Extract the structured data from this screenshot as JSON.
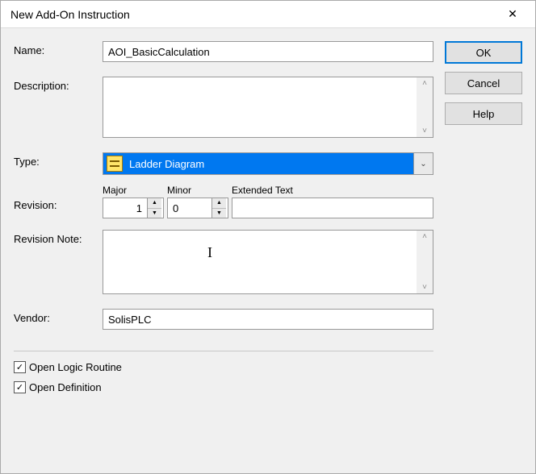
{
  "window": {
    "title": "New Add-On Instruction"
  },
  "buttons": {
    "ok": "OK",
    "cancel": "Cancel",
    "help": "Help"
  },
  "labels": {
    "name": "Name:",
    "description": "Description:",
    "type": "Type:",
    "revision": "Revision:",
    "revision_note": "Revision Note:",
    "vendor": "Vendor:",
    "major": "Major",
    "minor": "Minor",
    "extended_text": "Extended Text"
  },
  "fields": {
    "name": "AOI_BasicCalculation",
    "description": "",
    "type_selected": "Ladder Diagram",
    "major": "1",
    "minor": "0",
    "extended_text": "",
    "revision_note": "",
    "vendor": "SolisPLC"
  },
  "checks": {
    "open_logic_label": "Open Logic Routine",
    "open_logic_checked": true,
    "open_definition_label": "Open Definition",
    "open_definition_checked": true
  },
  "icons": {
    "check": "✓",
    "close": "✕",
    "up": "▲",
    "down": "▼",
    "dd_down": "⌄",
    "scroll_up": "˄",
    "scroll_down": "˅"
  }
}
